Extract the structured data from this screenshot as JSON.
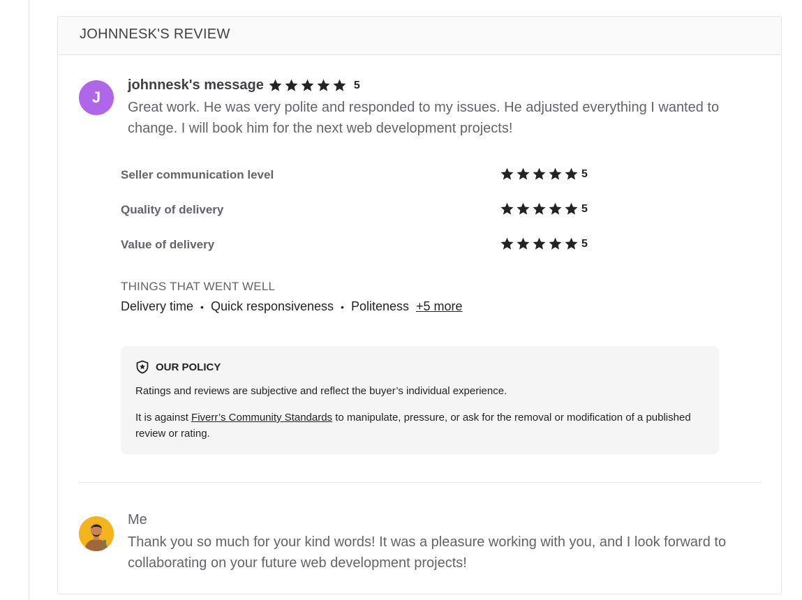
{
  "review": {
    "title": "JOHNNESK'S REVIEW",
    "avatar_letter": "J",
    "author_label": "johnnesk's message",
    "overall_rating": "5",
    "overall_stars": 5,
    "message": "Great work. He was very polite and responded to my issues. He adjusted everything I wanted to change. I will book him for the next web development projects!",
    "avatar_color": "#b066e8"
  },
  "ratings": [
    {
      "label": "Seller communication level",
      "stars": 5,
      "score": "5"
    },
    {
      "label": "Quality of delivery",
      "stars": 5,
      "score": "5"
    },
    {
      "label": "Value of delivery",
      "stars": 5,
      "score": "5"
    }
  ],
  "went_well": {
    "title": "THINGS THAT WENT WELL",
    "items": [
      "Delivery time",
      "Quick responsiveness",
      "Politeness"
    ],
    "separator": "•",
    "more_label": "+5 more"
  },
  "policy": {
    "icon": "shield-star-icon",
    "title": "OUR POLICY",
    "p1": "Ratings and reviews are subjective and reflect the buyer’s individual experience.",
    "p2_before": "It is against ",
    "p2_link": "Fiverr’s Community Standards",
    "p2_after": " to manipulate, pressure, or ask for the removal or modification of a published review or rating."
  },
  "reply": {
    "name": "Me",
    "message": "Thank you so much for your kind words! It was a pleasure working with you, and I look forward to collaborating on your future web development projects!",
    "avatar_color": "#f3b51b"
  },
  "colors": {
    "star": "#222325",
    "text": "#404145",
    "muted": "#62646a"
  }
}
